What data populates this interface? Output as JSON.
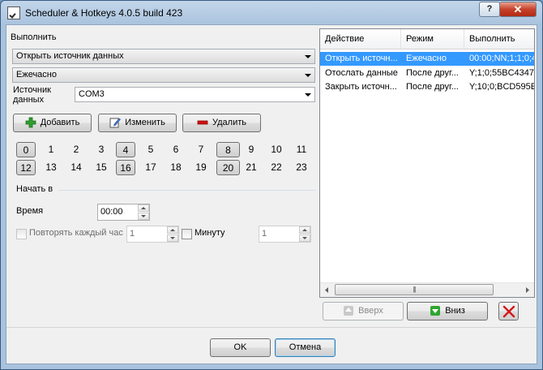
{
  "window": {
    "title": "Scheduler & Hotkeys 4.0.5 build 423",
    "help_label": "?",
    "close_label": "✕"
  },
  "left": {
    "execute_label": "Выполнить",
    "action_value": "Открыть источник данных",
    "mode_value": "Ежечасно",
    "source_label": "Источник данных",
    "source_value": "COM3",
    "add_label": "Добавить",
    "edit_label": "Изменить",
    "delete_label": "Удалить",
    "hours_row1": [
      "0",
      "1",
      "2",
      "3",
      "4",
      "5",
      "6",
      "7",
      "8",
      "9",
      "10",
      "11"
    ],
    "hours_row2": [
      "12",
      "13",
      "14",
      "15",
      "16",
      "17",
      "18",
      "19",
      "20",
      "21",
      "22",
      "23"
    ],
    "selected_hours": [
      "0",
      "4",
      "8",
      "12",
      "16",
      "20"
    ],
    "start_group": "Начать в",
    "time_label": "Время",
    "time_value": "00:00",
    "repeat_hour_label": "Повторять каждый час",
    "repeat_hour_value": "1",
    "minute_label": "Минуту",
    "minute_value": "1"
  },
  "list": {
    "columns": [
      "Действие",
      "Режим",
      "Выполнить"
    ],
    "rows": [
      [
        "Открыть источн...",
        "Ежечасно",
        "00:00;NN;1;1;0;4"
      ],
      [
        "Отослать данные",
        "После друг...",
        "Y;1;0;55BC4347"
      ],
      [
        "Закрыть источн...",
        "После друг...",
        "Y;10;0;BCD595E"
      ]
    ],
    "selected_row": 0,
    "up_label": "Вверх",
    "down_label": "Вниз"
  },
  "footer": {
    "ok_label": "OK",
    "cancel_label": "Отмена"
  },
  "colors": {
    "selection": "#3399ff",
    "titlebar": "#a9c3de",
    "close": "#c7412a",
    "add_icon": "#2e9e2e",
    "delete_icon": "#d01010"
  }
}
